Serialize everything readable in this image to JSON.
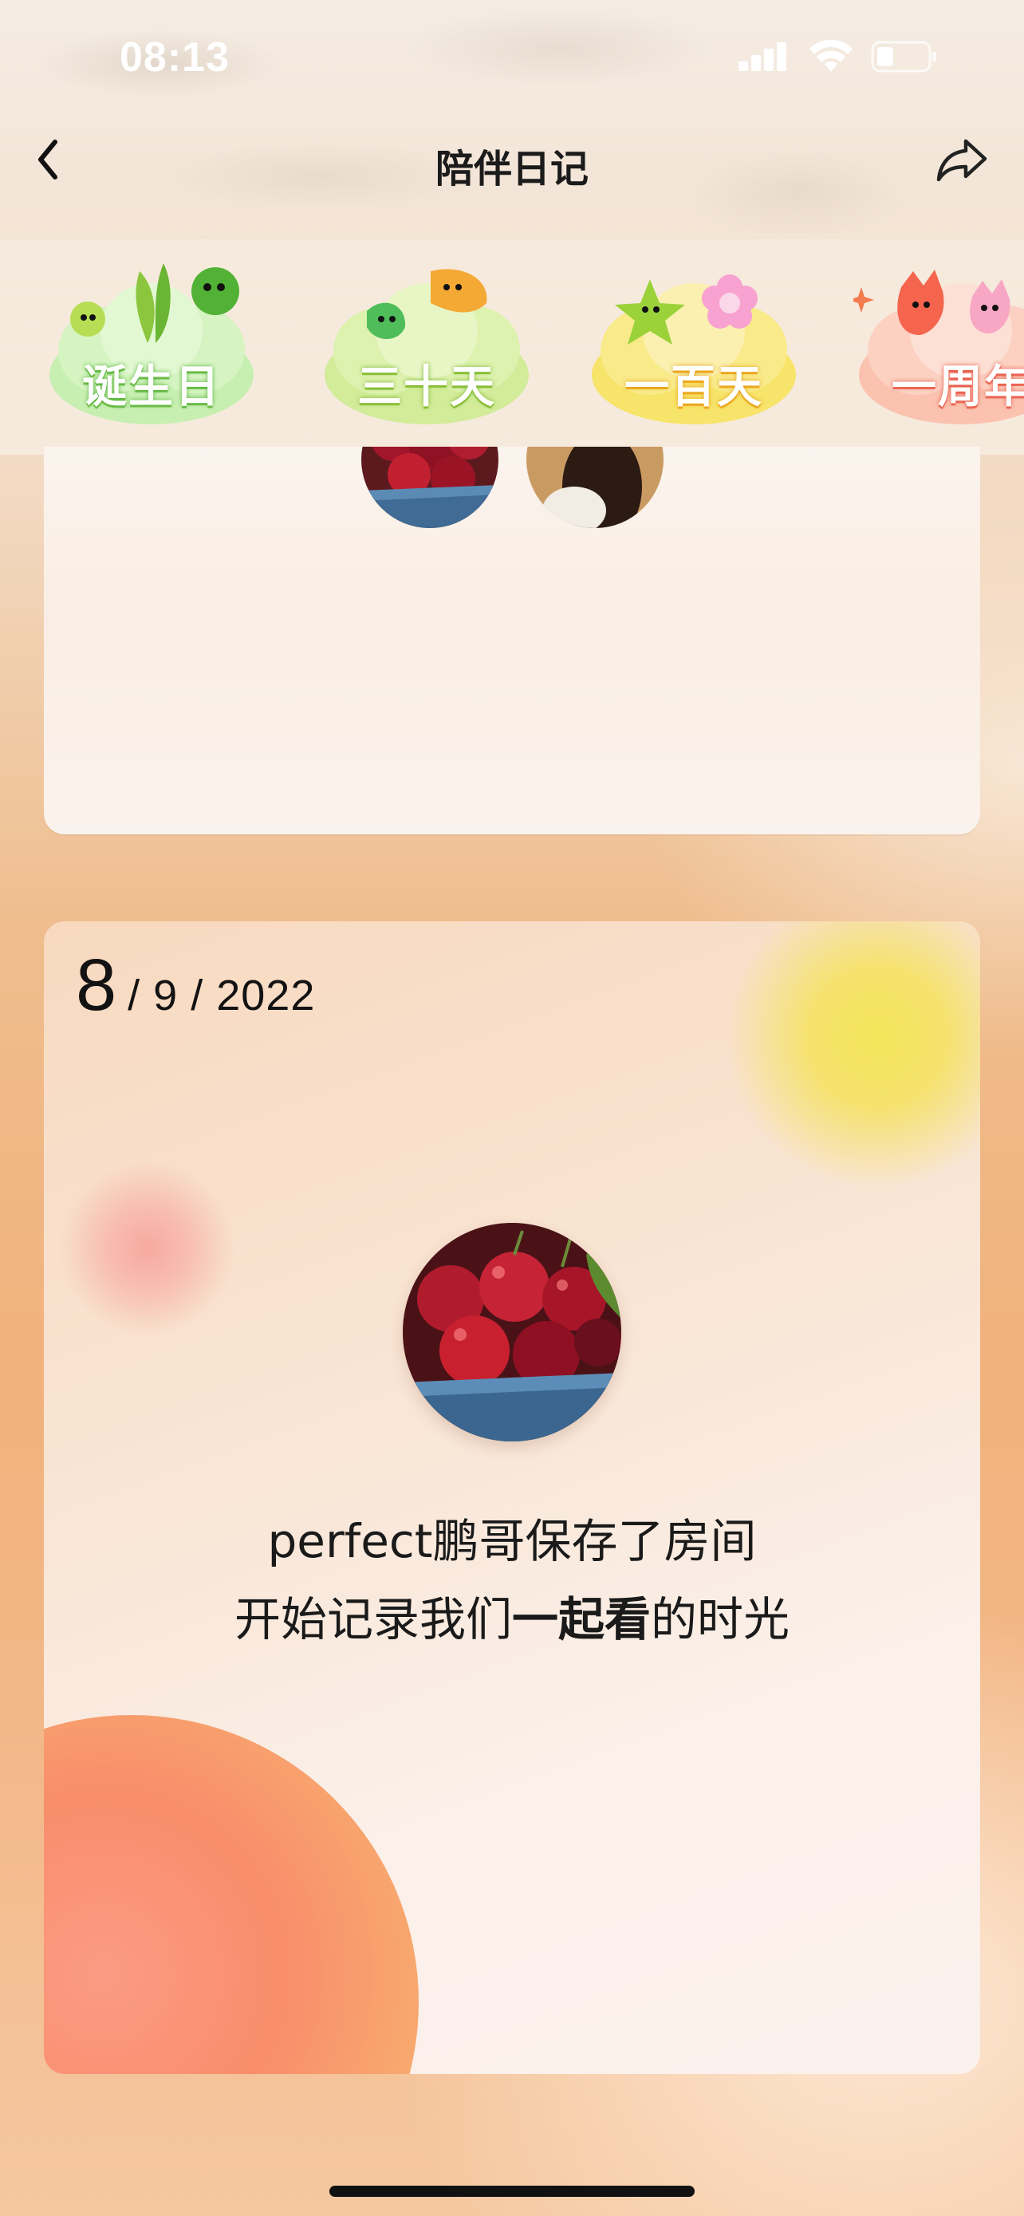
{
  "status_bar": {
    "time": "08:13",
    "icons": [
      "signal-icon",
      "wifi-icon",
      "battery-icon"
    ]
  },
  "nav": {
    "title": "陪伴日记",
    "back_icon": "chevron-left-icon",
    "share_icon": "share-arrow-icon"
  },
  "milestones": [
    {
      "label": "诞生日",
      "color": "#7fcf58"
    },
    {
      "label": "三十天",
      "color": "#9fcf3c"
    },
    {
      "label": "一百天",
      "color": "#f2c932"
    },
    {
      "label": "一周年",
      "color": "#f8846e"
    }
  ],
  "card_main": {
    "date_day": "8",
    "date_rest": "/ 9 / 2022",
    "message_line1": "perfect鹏哥保存了房间",
    "message_line2_a": "开始记录我们",
    "message_line2_bold": "一起看",
    "message_line2_b": "的时光"
  },
  "colors": {
    "accent_yellow": "#f3e65a",
    "accent_orange": "#f98d6b",
    "text": "#1a1a1a"
  }
}
